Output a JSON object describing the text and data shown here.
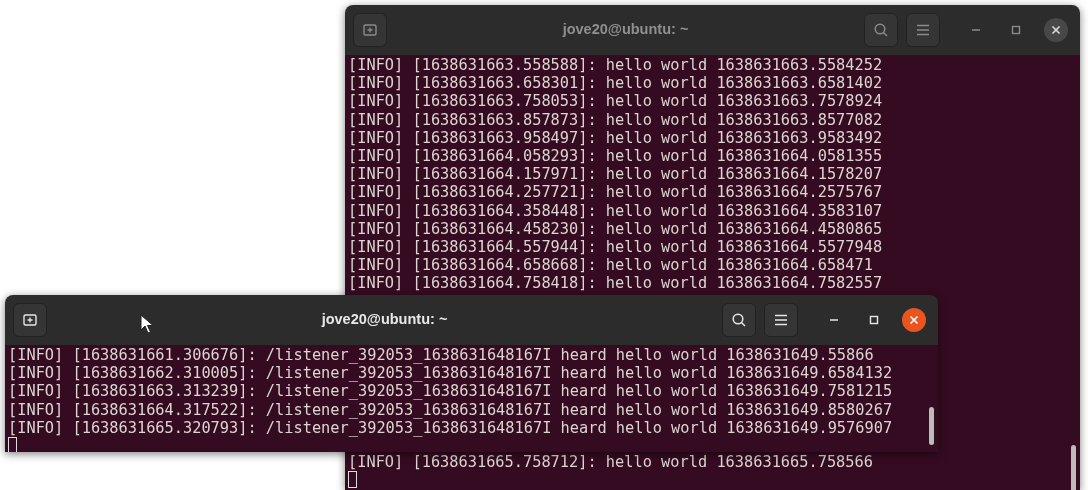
{
  "windows": [
    {
      "title": "jove20@ubuntu: ~",
      "active": false,
      "lines": [
        "[INFO] [1638631663.558588]: hello world 1638631663.5584252",
        "[INFO] [1638631663.658301]: hello world 1638631663.6581402",
        "[INFO] [1638631663.758053]: hello world 1638631663.7578924",
        "[INFO] [1638631663.857873]: hello world 1638631663.8577082",
        "[INFO] [1638631663.958497]: hello world 1638631663.9583492",
        "[INFO] [1638631664.058293]: hello world 1638631664.0581355",
        "[INFO] [1638631664.157971]: hello world 1638631664.1578207",
        "[INFO] [1638631664.257721]: hello world 1638631664.2575767",
        "[INFO] [1638631664.358448]: hello world 1638631664.3583107",
        "[INFO] [1638631664.458230]: hello world 1638631664.4580865",
        "[INFO] [1638631664.557944]: hello world 1638631664.5577948",
        "[INFO] [1638631664.658668]: hello world 1638631664.658471",
        "[INFO] [1638631664.758418]: hello world 1638631664.7582557"
      ],
      "lines_after_overlap": [
        "[INFO] [1638631665.758712]: hello world 1638631665.758566"
      ]
    },
    {
      "title": "jove20@ubuntu: ~",
      "active": true,
      "lines": [
        "[INFO] [1638631661.306676]: /listener_392053_1638631648167I heard hello world 1638631649.55866",
        "[INFO] [1638631662.310005]: /listener_392053_1638631648167I heard hello world 1638631649.6584132",
        "[INFO] [1638631663.313239]: /listener_392053_1638631648167I heard hello world 1638631649.7581215",
        "[INFO] [1638631664.317522]: /listener_392053_1638631648167I heard hello world 1638631649.8580267",
        "[INFO] [1638631665.320793]: /listener_392053_1638631648167I heard hello world 1638631649.9576907"
      ]
    }
  ]
}
